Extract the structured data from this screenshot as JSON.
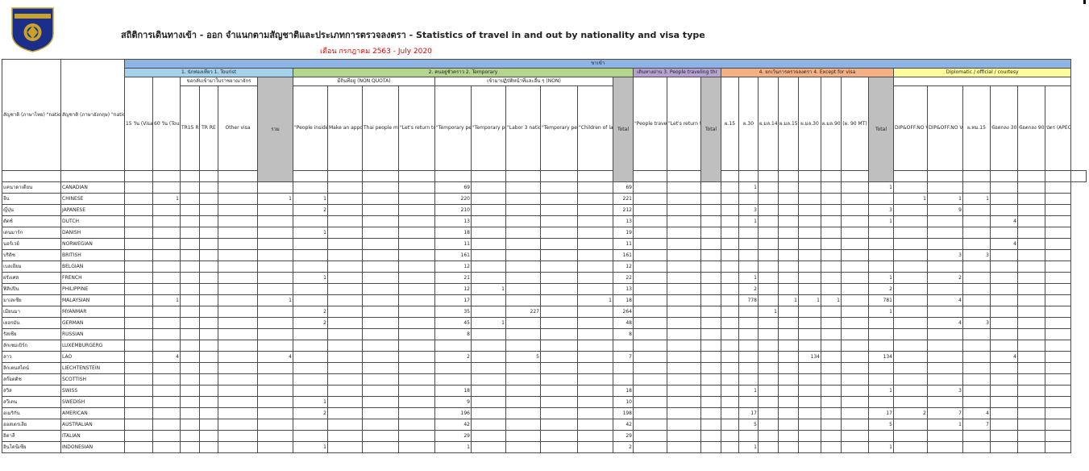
{
  "logo": {
    "top_text": "ROYAL THAI POLICE",
    "band_text": "IMMIGRATION BUREAU"
  },
  "title": "สถิติการเดินทางเข้า - ออก จำแนกตามสัญชาติและประเภทการตรวจลงตรา - Statistics of travel in and out by nationality and visa type",
  "subtitle": "เดือน กรกฎาคม 2563 - July 2020",
  "header": {
    "row1_label": "ขาเข้า",
    "nat_th": "สัญชาติ (ภาษาไทย) \"nationality (Thai language) \"",
    "nat_en": "สัญชาติ (ภาษาอังกฤษ) \"nationality (in English) \"",
    "groups": {
      "tourist": "1. นักท่องเที่ยว 1. Tourist",
      "temporary": "2. คนอยู่ชั่วคราว 2. Temporary",
      "transit": "เดินทางผ่าน 3. People traveling thr",
      "except": "4. ยกเว้นการตรวจลงตรา 4. Except for visa",
      "diplomatic": "Diplomatic / official / courtesy"
    },
    "subgroups": {
      "tourist_visa": "ขอกลับเข้ามาในราชอาณาจักร",
      "nonquota": "มีถิ่นที่อยู่ (NON QUOTA)",
      "non": "เข้ามาปฏิบัติหน้าที่และอื่น ๆ (NON)"
    },
    "columns": {
      "c15": "15 วัน (Visa on Arrival) TR15",
      "c60": "60 วัน (Tourist Visa)",
      "tr15re": "TR15 RE",
      "trre": "TR RE",
      "other": "Other visa",
      "total_red": "รวม",
      "people_inside": "\"People inside (Foreigners in Thailand) \"",
      "appointment": "Make an appointment",
      "thai_people": "Thai people make an appointment for reporting",
      "return_kingdom": "\"Let's return to the Kingdom (NON RE) \"",
      "temp90": "\"Temporary people (NON 90) \"",
      "temp1": "\"Temporary people (NON 1 YEAR) \"",
      "labor3": "\"Labor 3 nationalities (NON LA 2 YEAR) \"",
      "special": "\"Temporary people are special (3 YEAR) \"",
      "children": "\"Children of labor 3 nationalities NON O (LA) \"",
      "total": "Total",
      "transit30": "\"People travel through 30 days (TS) \"",
      "return_ts": "\"Let's return to the Kingdom (TS RE) \"",
      "total_tr": "Total",
      "ps15": "ผ.15",
      "ps30": "ผ.30",
      "ps_ml14": "ผ.มล.14",
      "ps_ml15": "ผ.มล.15",
      "ps_ml30": "ผ.มล.30",
      "ps_ml90": "ผ.มล.90",
      "ps90mt": "(ผ. 90 MT)",
      "total_ex": "Total",
      "dip30": "DIP&OFF.NO VISA (NON 30)",
      "dip90": "DIP&OFF.NO VISA (NON 90)",
      "pm15": "ผ.ทม.15",
      "cy30": "ข้อตกลง 30 วัน (CY 30)",
      "cy90": "ข้อตกลง 90 วัน (CY 90)",
      "apec": "บัตร (APEC)"
    }
  },
  "rows": [
    {
      "th": "แคนาดาเดียน",
      "en": "CANADIAN",
      "c": {
        "t90": "69",
        "tot": "69",
        "ps30": "1",
        "totx": "1"
      }
    },
    {
      "th": "จีน",
      "en": "CHINESE",
      "c": {
        "c60": "1",
        "rv": "1",
        "pi": "1",
        "t90": "220",
        "tot": "221",
        "d30": "1",
        "d90": "1",
        "pm15": "1"
      }
    },
    {
      "th": "ญี่ปุ่น",
      "en": "JAPANESE",
      "c": {
        "pi": "2",
        "t90": "210",
        "tot": "212",
        "ps30": "3",
        "totx": "3",
        "d90": "9"
      }
    },
    {
      "th": "ดัตช์",
      "en": "DUTCH",
      "c": {
        "t90": "13",
        "tot": "13",
        "ps30": "1",
        "totx": "1",
        "cy30": "4"
      }
    },
    {
      "th": "เดนมาร์ก",
      "en": "DANISH",
      "c": {
        "pi": "1",
        "t90": "18",
        "tot": "19"
      }
    },
    {
      "th": "นอร์เวย์",
      "en": "NORWEGIAN",
      "c": {
        "t90": "11",
        "tot": "11",
        "cy30": "4"
      }
    },
    {
      "th": "บริติช",
      "en": "BRITISH",
      "c": {
        "t90": "161",
        "tot": "161",
        "d90": "3",
        "pm15": "3"
      }
    },
    {
      "th": "เบลเยียม",
      "en": "BELGIAN",
      "c": {
        "t90": "12",
        "tot": "12"
      }
    },
    {
      "th": "ฝรั่งเศส",
      "en": "FRENCH",
      "c": {
        "pi": "1",
        "t90": "21",
        "tot": "22",
        "ps30": "1",
        "totx": "1",
        "d90": "2"
      }
    },
    {
      "th": "ฟิลิปปิน",
      "en": "PHILIPPINE",
      "c": {
        "t90": "12",
        "t1": "1",
        "tot": "13",
        "ps30": "2",
        "totx": "2"
      }
    },
    {
      "th": "มาเลเซีย",
      "en": "MALAYSIAN",
      "c": {
        "c60": "1",
        "rv": "1",
        "t90": "17",
        "ch": "1",
        "tot": "18",
        "ps30": "778",
        "ml15": "1",
        "ml30": "1",
        "ml90": "1",
        "totx": "781",
        "d90": "4"
      }
    },
    {
      "th": "เมียนมา",
      "en": "MYANMAR",
      "c": {
        "pi": "2",
        "t90": "35",
        "lab": "227",
        "tot": "264",
        "ml14": "1",
        "totx": "1"
      }
    },
    {
      "th": "เยอรมัน",
      "en": "GERMAN",
      "c": {
        "pi": "2",
        "t90": "45",
        "t1": "1",
        "tot": "48",
        "d90": "4",
        "pm15": "3"
      }
    },
    {
      "th": "รัสเซีย",
      "en": "RUSSIAN",
      "c": {
        "t90": "8",
        "tot": "8"
      }
    },
    {
      "th": "ลักเซมเบิร์ก",
      "en": "LUXEMBURGERG",
      "c": {}
    },
    {
      "th": "ลาว",
      "en": "LAO",
      "c": {
        "c60": "4",
        "rv": "4",
        "t90": "2",
        "lab": "5",
        "tot": "7",
        "ml30": "134",
        "totx": "134",
        "cy30": "4"
      }
    },
    {
      "th": "ลิกเตนสไตน์",
      "en": "LIECHTENSTEIN",
      "c": {}
    },
    {
      "th": "สก๊อตติช",
      "en": "SCOTTISH",
      "c": {}
    },
    {
      "th": "สวิส",
      "en": "SWISS",
      "c": {
        "t90": "18",
        "tot": "18",
        "ps30": "1",
        "totx": "1",
        "d90": "3"
      }
    },
    {
      "th": "สวีเดน",
      "en": "SWEDISH",
      "c": {
        "pi": "1",
        "t90": "9",
        "tot": "10"
      }
    },
    {
      "th": "อเมริกัน",
      "en": "AMERICAN",
      "c": {
        "pi": "2",
        "t90": "196",
        "tot": "198",
        "ps30": "17",
        "totx": "17",
        "d30": "2",
        "d90": "7",
        "pm15": "4"
      }
    },
    {
      "th": "ออสเตรเลีย",
      "en": "AUSTRALIAN",
      "c": {
        "t90": "42",
        "tot": "42",
        "ps30": "5",
        "totx": "5",
        "d90": "1",
        "pm15": "7"
      }
    },
    {
      "th": "อิตาลี",
      "en": "ITALIAN",
      "c": {
        "t90": "29",
        "tot": "29"
      }
    },
    {
      "th": "อินโดนีเซีย",
      "en": "INDONESIAN",
      "c": {
        "pi": "1",
        "t90": "1",
        "tot": "2",
        "ps30": "1",
        "totx": "1"
      }
    }
  ],
  "colors": {
    "blue": "#8fb4e3",
    "skyblue": "#a4d2ec",
    "green": "#b5d58c",
    "purple": "#b7a2d3",
    "orange": "#f5b183",
    "yellow": "#fdfd99",
    "gray": "#bfbfbf",
    "red": "#e00000"
  }
}
